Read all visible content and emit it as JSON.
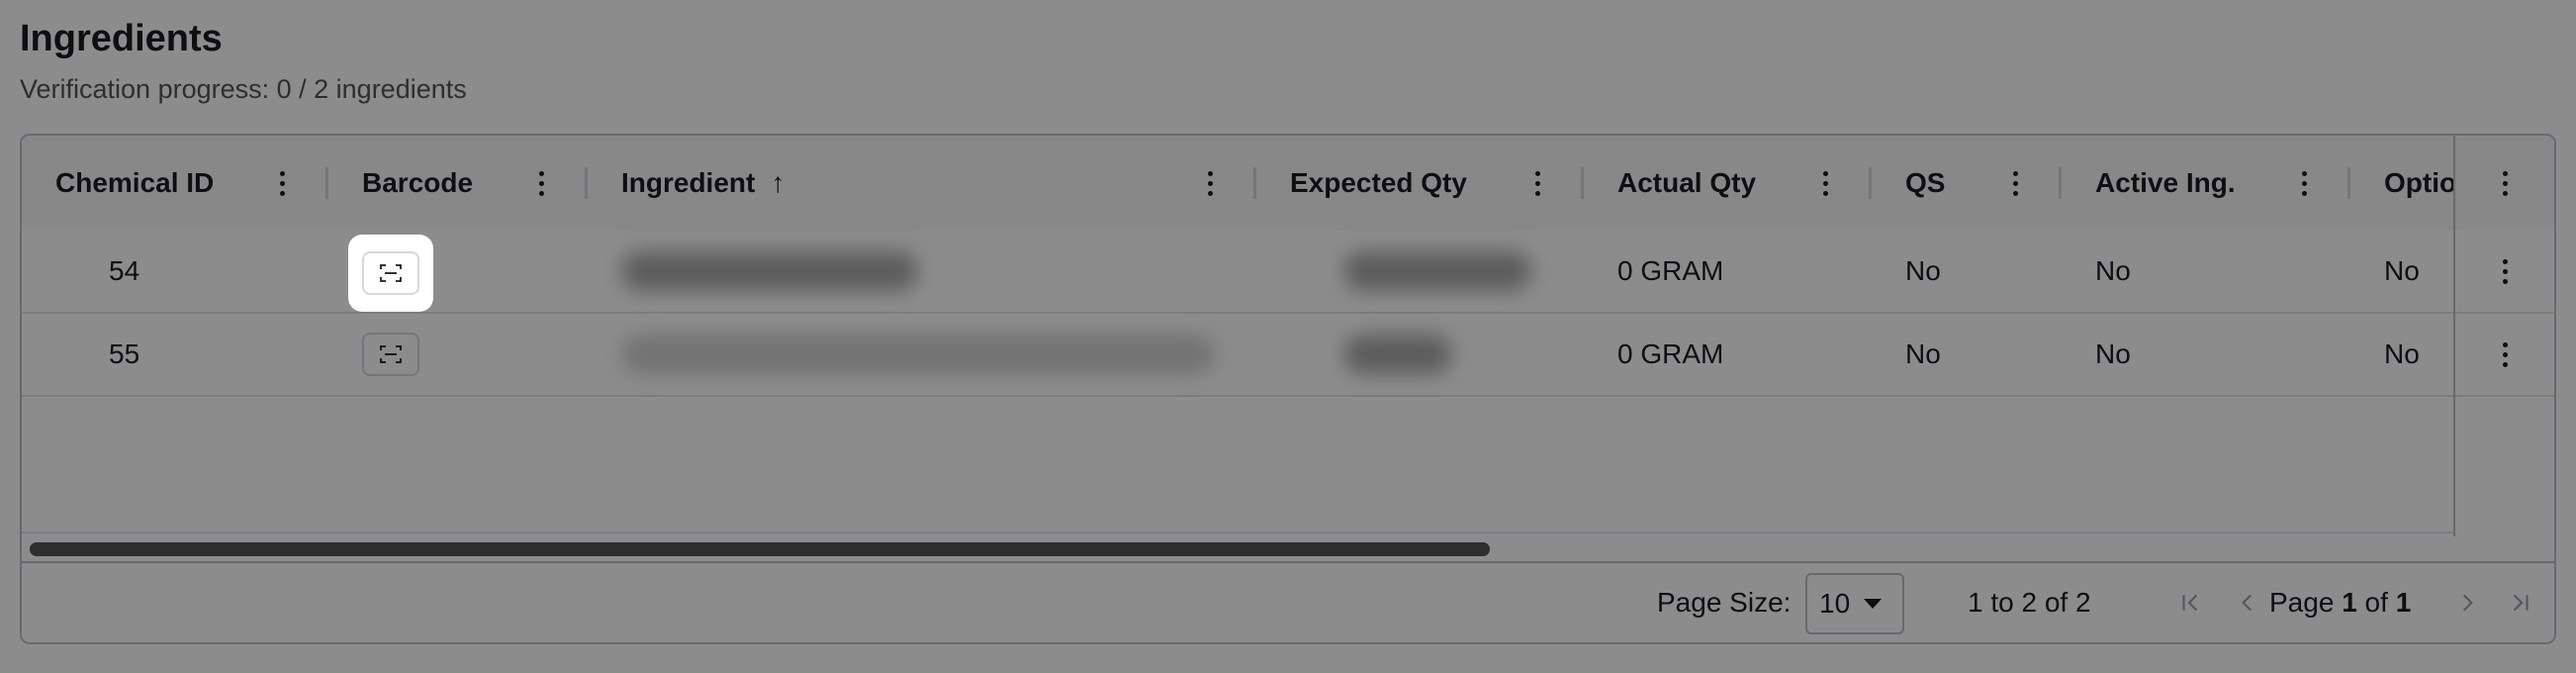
{
  "page": {
    "title": "Ingredients",
    "subtitle": "Verification progress: 0 / 2 ingredients"
  },
  "columns": [
    {
      "label": "Chemical ID"
    },
    {
      "label": "Barcode"
    },
    {
      "label": "Ingredient",
      "sort": "ascending",
      "sort_icon": "arrow-up-icon"
    },
    {
      "label": "Expected Qty"
    },
    {
      "label": "Actual Qty"
    },
    {
      "label": "QS"
    },
    {
      "label": "Active Ing."
    },
    {
      "label": "Optio"
    }
  ],
  "rows": [
    {
      "chemical_id": "54",
      "barcode_icon": "scan-icon",
      "ingredient": "",
      "expected_qty": "",
      "actual_qty": "0 GRAM",
      "qs": "No",
      "active_ing": "No",
      "optional": "No"
    },
    {
      "chemical_id": "55",
      "barcode_icon": "scan-icon",
      "ingredient": "",
      "expected_qty": "",
      "actual_qty": "0 GRAM",
      "qs": "No",
      "active_ing": "No",
      "optional": "No"
    }
  ],
  "pagination": {
    "page_size_label": "Page Size:",
    "page_size": "10",
    "range": "1 to 2 of 2",
    "page_prefix": "Page",
    "current_page": "1",
    "page_of": "of",
    "total_pages": "1"
  },
  "colors": {
    "overlay": "#000000",
    "border": "#babfc7",
    "text": "#181d1f"
  }
}
